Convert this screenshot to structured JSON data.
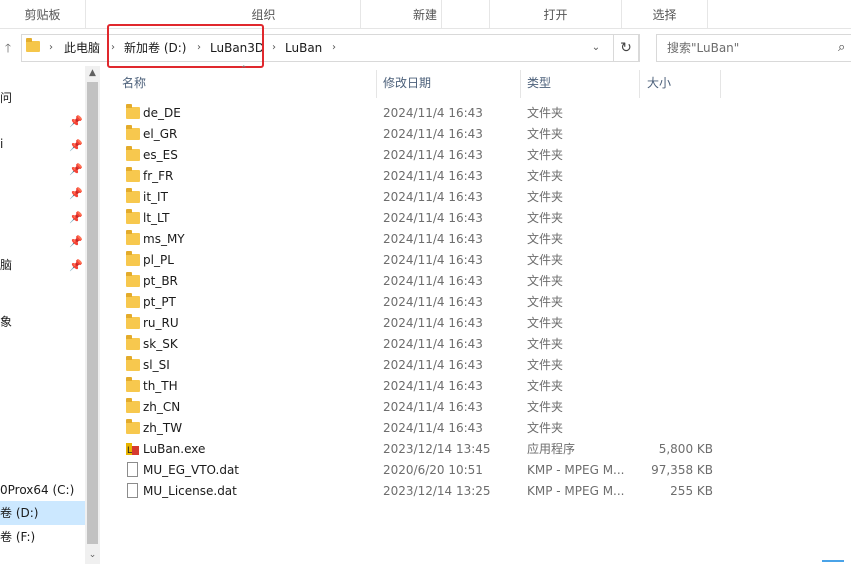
{
  "ribbon": {
    "groups": [
      "剪贴板",
      "组织",
      "新建",
      "打开",
      "选择"
    ]
  },
  "address": {
    "crumbs": [
      "此电脑",
      "新加卷 (D:)",
      "LuBan3D",
      "LuBan"
    ],
    "search_placeholder": "搜索\"LuBan\""
  },
  "nav": {
    "items": [
      "问",
      "i",
      "脑",
      "象",
      "0Prox64 (C:)",
      "卷 (D:)",
      "卷 (F:)"
    ]
  },
  "columns": {
    "name": "名称",
    "date": "修改日期",
    "type": "类型",
    "size": "大小"
  },
  "files": [
    {
      "name": "de_DE",
      "date": "2024/11/4 16:43",
      "type": "文件夹",
      "size": "",
      "icon": "folder"
    },
    {
      "name": "el_GR",
      "date": "2024/11/4 16:43",
      "type": "文件夹",
      "size": "",
      "icon": "folder"
    },
    {
      "name": "es_ES",
      "date": "2024/11/4 16:43",
      "type": "文件夹",
      "size": "",
      "icon": "folder"
    },
    {
      "name": "fr_FR",
      "date": "2024/11/4 16:43",
      "type": "文件夹",
      "size": "",
      "icon": "folder"
    },
    {
      "name": "it_IT",
      "date": "2024/11/4 16:43",
      "type": "文件夹",
      "size": "",
      "icon": "folder"
    },
    {
      "name": "lt_LT",
      "date": "2024/11/4 16:43",
      "type": "文件夹",
      "size": "",
      "icon": "folder"
    },
    {
      "name": "ms_MY",
      "date": "2024/11/4 16:43",
      "type": "文件夹",
      "size": "",
      "icon": "folder"
    },
    {
      "name": "pl_PL",
      "date": "2024/11/4 16:43",
      "type": "文件夹",
      "size": "",
      "icon": "folder"
    },
    {
      "name": "pt_BR",
      "date": "2024/11/4 16:43",
      "type": "文件夹",
      "size": "",
      "icon": "folder"
    },
    {
      "name": "pt_PT",
      "date": "2024/11/4 16:43",
      "type": "文件夹",
      "size": "",
      "icon": "folder"
    },
    {
      "name": "ru_RU",
      "date": "2024/11/4 16:43",
      "type": "文件夹",
      "size": "",
      "icon": "folder"
    },
    {
      "name": "sk_SK",
      "date": "2024/11/4 16:43",
      "type": "文件夹",
      "size": "",
      "icon": "folder"
    },
    {
      "name": "sl_SI",
      "date": "2024/11/4 16:43",
      "type": "文件夹",
      "size": "",
      "icon": "folder"
    },
    {
      "name": "th_TH",
      "date": "2024/11/4 16:43",
      "type": "文件夹",
      "size": "",
      "icon": "folder"
    },
    {
      "name": "zh_CN",
      "date": "2024/11/4 16:43",
      "type": "文件夹",
      "size": "",
      "icon": "folder"
    },
    {
      "name": "zh_TW",
      "date": "2024/11/4 16:43",
      "type": "文件夹",
      "size": "",
      "icon": "folder"
    },
    {
      "name": "LuBan.exe",
      "date": "2023/12/14 13:45",
      "type": "应用程序",
      "size": "5,800 KB",
      "icon": "exe"
    },
    {
      "name": "MU_EG_VTO.dat",
      "date": "2020/6/20 10:51",
      "type": "KMP - MPEG M...",
      "size": "97,358 KB",
      "icon": "file"
    },
    {
      "name": "MU_License.dat",
      "date": "2023/12/14 13:25",
      "type": "KMP - MPEG M...",
      "size": "255 KB",
      "icon": "file"
    }
  ],
  "colors": {
    "highlight_box": "#e0282d",
    "folder": "#f7c84e",
    "selection": "#cce8ff"
  }
}
